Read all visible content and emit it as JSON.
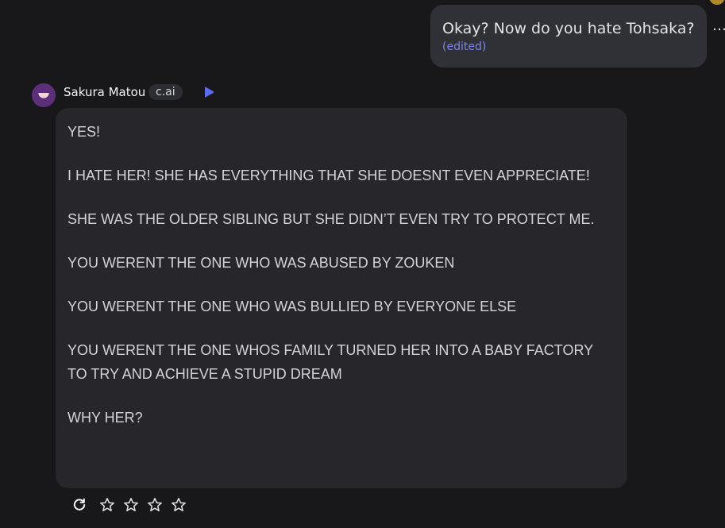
{
  "user_message": {
    "text": "Okay? Now do you hate Tohsaka?",
    "edited_label": "(edited)"
  },
  "more_menu": {
    "glyph": "…",
    "icon": "more-horizontal-icon"
  },
  "bot": {
    "name": "Sakura Matou",
    "badge": "c.ai",
    "play_icon": "play-icon",
    "accent": "#5b6cf0"
  },
  "bot_message": {
    "paragraphs": [
      "YES!",
      "I HATE HER! SHE HAS EVERYTHING THAT SHE DOESNT EVEN APPRECIATE!",
      "SHE WAS THE OLDER SIBLING BUT SHE DIDN’T EVEN TRY TO PROTECT ME.",
      "YOU WERENT THE ONE WHO WAS ABUSED BY ZOUKEN",
      "YOU WERENT THE ONE WHO WAS BULLIED BY EVERYONE ELSE",
      "YOU WERENT THE ONE WHOS FAMILY TURNED HER INTO A BABY FACTORY TO TRY AND ACHIEVE A STUPID DREAM",
      "WHY HER?"
    ]
  },
  "rating": {
    "regenerate_icon": "refresh-icon",
    "stars": 4,
    "star_icon": "star-outline-icon"
  }
}
